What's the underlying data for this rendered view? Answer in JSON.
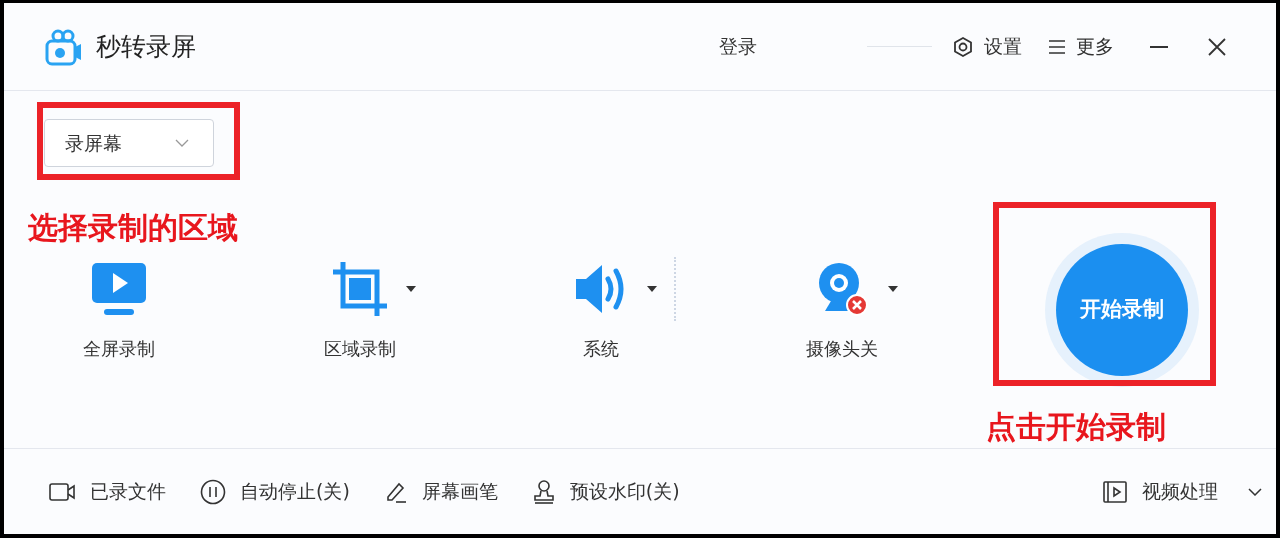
{
  "app": {
    "title": "秒转录屏"
  },
  "header": {
    "login": "登录",
    "settings": "设置",
    "more": "更多"
  },
  "mode_select": {
    "value": "录屏幕"
  },
  "tools": [
    {
      "kind": "fullscreen",
      "label": "全屏录制",
      "has_menu": false
    },
    {
      "kind": "region",
      "label": "区域录制",
      "has_menu": true
    },
    {
      "kind": "audio",
      "label": "系统",
      "has_menu": true
    },
    {
      "kind": "camera",
      "label": "摄像头关",
      "has_menu": true
    }
  ],
  "start_button": "开始录制",
  "annotations": [
    {
      "text": "选择录制的区域"
    },
    {
      "text": "点击开始录制"
    }
  ],
  "bottom_bar": [
    {
      "kind": "files",
      "label": "已录文件"
    },
    {
      "kind": "autostop",
      "label": "自动停止(关)"
    },
    {
      "kind": "pen",
      "label": "屏幕画笔"
    },
    {
      "kind": "watermark",
      "label": "预设水印(关)"
    },
    {
      "kind": "video",
      "label": "视频处理"
    }
  ]
}
